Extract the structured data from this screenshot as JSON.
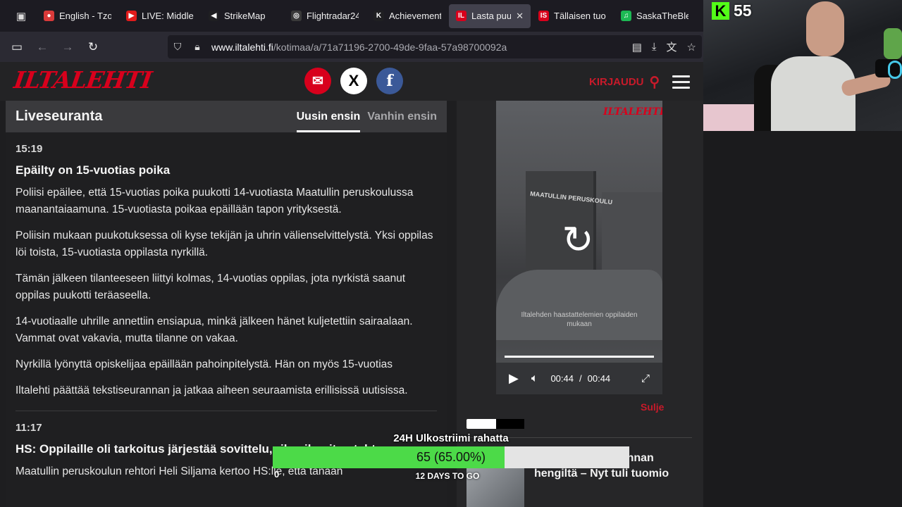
{
  "browser": {
    "tabs": [
      {
        "label": "English - Tzotz",
        "color": "#d93a3a",
        "icon_text": "●"
      },
      {
        "label": "LIVE: Middle East",
        "color": "#e21b1b",
        "icon_text": "▶"
      },
      {
        "label": "StrikeMap",
        "color": "#1f1f22",
        "icon_text": "◀"
      },
      {
        "label": "Flightradar24",
        "color": "#3a3a3a",
        "icon_text": "◎"
      },
      {
        "label": "Achievements",
        "color": "#1f1f22",
        "icon_text": "K"
      },
      {
        "label": "Lasta puukotti",
        "color": "#d8001c",
        "icon_text": "IL",
        "active": true
      },
      {
        "label": "Tällaisen tuomion",
        "color": "#d8001c",
        "icon_text": "IS"
      },
      {
        "label": "SaskaTheBlessed",
        "color": "#1db954",
        "icon_text": "♫"
      }
    ],
    "url_domain": "www.iltalehti.fi",
    "url_path": "/kotimaa/a/71a71196-2700-49de-9faa-57a98700092a",
    "icons": [
      "tab-list-icon",
      "sidebar-icon",
      "back-icon",
      "forward-icon",
      "reload-icon",
      "shield-icon",
      "lock-icon",
      "reader-icon",
      "save-icon",
      "translate-icon",
      "star-icon"
    ]
  },
  "site": {
    "logo": "ILTALEHTI",
    "login_label": "KIRJAUDU",
    "social": {
      "mail": "✉",
      "x": "X",
      "facebook": "f"
    }
  },
  "live": {
    "title": "Liveseuranta",
    "sort_newest": "Uusin ensin",
    "sort_oldest": "Vanhin ensin",
    "entries": [
      {
        "time": "15:19",
        "heading": "Epäilty on 15-vuotias poika",
        "paragraphs": [
          "Poliisi epäilee, että 15-vuotias poika puukotti 14-vuotiasta Maatullin peruskoulussa maanantaiaamuna. 15-vuotiasta poikaa epäillään tapon yrityksestä.",
          "Poliisin mukaan puukotuksessa oli kyse tekijän ja uhrin välienselvittelystä. Yksi oppilas löi toista, 15-vuotiasta oppilasta nyrkillä.",
          "Tämän jälkeen tilanteeseen liittyi kolmas, 14-vuotias oppilas, jota nyrkistä saanut oppilas puukotti teräaseella.",
          "14-vuotiaalle uhrille annettiin ensiapua, minkä jälkeen hänet kuljetettiin sairaalaan. Vammat ovat vakavia, mutta tilanne on vakaa.",
          "Nyrkillä lyönyttä opiskelijaa epäillään pahoinpitelystä. Hän on myös 15-vuotias",
          "Iltalehti päättää tekstiseurannan ja jatkaa aiheen seuraamista erillisissä uutisissa."
        ]
      },
      {
        "time": "11:17",
        "heading": "HS: Oppilaille oli tarkoitus järjestää sovittelu, rikosilmoitus tehty",
        "paragraphs": [
          "Maatullin peruskoulun rehtori Heli Siljama kertoo HS:lle, että tänään"
        ]
      }
    ]
  },
  "video": {
    "logo": "ILTALEHTI",
    "sign_text": "MAATULLIN PERUSKOULU",
    "caption": "Iltalehden haastattelemien oppilaiden mukaan",
    "current_time": "00:44",
    "separator": "/",
    "duration": "00:44",
    "close_label": "Sulje",
    "progress": 1.0
  },
  "related": {
    "headline": "…ski ajoi pariskunnan hengiltä – Nyt tuli tuomio"
  },
  "donation": {
    "title": "24H Ulkostriimi rahatta",
    "value_text": "65 (65.00%)",
    "fraction": 0.65,
    "min_label": "0",
    "sub_label": "12 DAYS TO GO",
    "fill_color": "#4cda48"
  },
  "stream": {
    "kick_letter": "K",
    "viewer_count": "55",
    "kick_color": "#53fc18"
  }
}
